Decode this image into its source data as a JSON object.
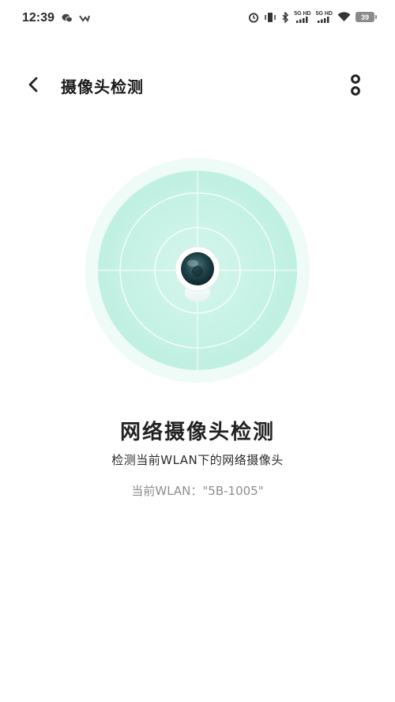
{
  "status_bar": {
    "time": "12:39",
    "signal1_label": "5G HD",
    "signal2_label": "5G HD",
    "battery": "39",
    "icons": [
      "wechat-icon",
      "notification-icon",
      "alarm-icon",
      "vibrate-icon",
      "bluetooth-icon",
      "signal-icon",
      "wifi-icon",
      "battery-icon"
    ]
  },
  "header": {
    "title": "摄像头检测",
    "back_icon": "chevron-left-icon",
    "more_icon": "more-vertical-icon"
  },
  "detection": {
    "title": "网络摄像头检测",
    "subtitle": "检测当前WLAN下的网络摄像头",
    "wlan_text": "当前WLAN：\"5B-1005\""
  },
  "colors": {
    "radar_outer": "#eefbf7",
    "radar_inner": "#c7f2e6",
    "camera_lens": "#1d3d42",
    "text_primary": "#222222",
    "text_secondary": "#8d8d8d"
  }
}
